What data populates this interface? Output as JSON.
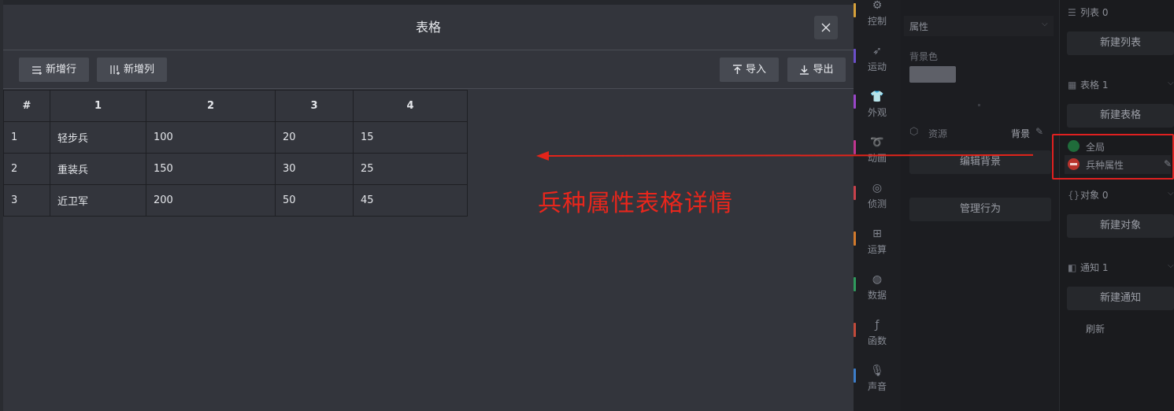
{
  "modal": {
    "title": "表格",
    "toolbar": {
      "add_row": "新增行",
      "add_col": "新增列",
      "import": "导入",
      "export": "导出"
    },
    "table": {
      "headers": [
        "#",
        "1",
        "2",
        "3",
        "4"
      ],
      "rows": [
        [
          "1",
          "轻步兵",
          "100",
          "20",
          "15"
        ],
        [
          "2",
          "重装兵",
          "150",
          "30",
          "25"
        ],
        [
          "3",
          "近卫军",
          "200",
          "50",
          "45"
        ]
      ]
    }
  },
  "categories": [
    {
      "label": "控制",
      "icon": "control-icon",
      "color": "#d7a13a"
    },
    {
      "label": "运动",
      "icon": "motion-icon",
      "color": "#6b4fc9"
    },
    {
      "label": "外观",
      "icon": "looks-icon",
      "color": "#9a46c9"
    },
    {
      "label": "动画",
      "icon": "animation-icon",
      "color": "#c0358f"
    },
    {
      "label": "侦测",
      "icon": "sensing-icon",
      "color": "#c8414b"
    },
    {
      "label": "运算",
      "icon": "operators-icon",
      "color": "#d37a2c"
    },
    {
      "label": "数据",
      "icon": "data-icon",
      "color": "#2f9a5c"
    },
    {
      "label": "函数",
      "icon": "function-icon",
      "color": "#c24a3a"
    },
    {
      "label": "声音",
      "icon": "sound-icon",
      "color": "#3c7dc9"
    }
  ],
  "properties": {
    "title": "属性",
    "bg_color_label": "背景色",
    "bg_color_value": "#5e6068",
    "resource_label": "资源",
    "resource_value": "背景",
    "edit_bg_button": "编辑背景",
    "manage_behavior_button": "管理行为"
  },
  "resources": {
    "list_header": "列表 0",
    "new_list": "新建列表",
    "table_header": "表格 1",
    "new_table": "新建表格",
    "global_label": "全局",
    "table_item": "兵种属性",
    "object_header": "对象 0",
    "new_object": "新建对象",
    "notice_header": "通知 1",
    "new_notice": "新建通知",
    "refresh": "刷新"
  },
  "annotation": "兵种属性表格详情"
}
